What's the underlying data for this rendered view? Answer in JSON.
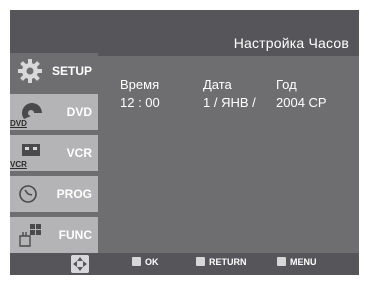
{
  "header": {
    "title": "Настройка Часов"
  },
  "sidebar": {
    "items": [
      {
        "label": "SETUP",
        "icon": "gear-icon",
        "active": true
      },
      {
        "label": "DVD",
        "icon": "dvd-disc-icon",
        "tag": "DVD"
      },
      {
        "label": "VCR",
        "icon": "vcr-cassette-icon",
        "tag": "VCR"
      },
      {
        "label": "PROG",
        "icon": "clock-icon"
      },
      {
        "label": "FUNC",
        "icon": "hand-grid-icon"
      }
    ]
  },
  "clock": {
    "time_label": "Время",
    "date_label": "Дата",
    "year_label": "Год",
    "time_value": "12 : 00",
    "date_value": "1 / ЯНВ /",
    "year_value": "2004 СР"
  },
  "footer": {
    "nav_icon": "dpad-icon",
    "ok_label": "OK",
    "return_label": "RETURN",
    "menu_label": "MENU"
  },
  "colors": {
    "screen_bg": "#6e6e70",
    "bar_bg": "#56565a",
    "sidebar_inactive": "#b4b4b6"
  }
}
